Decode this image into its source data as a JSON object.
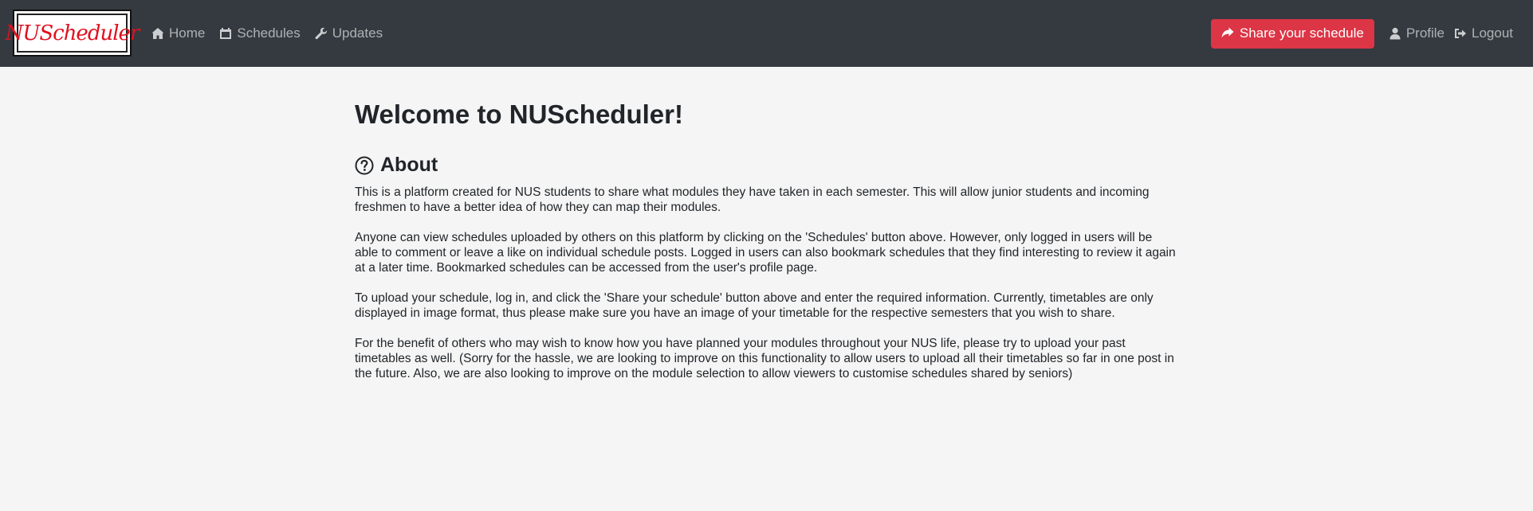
{
  "navbar": {
    "brand": "NUScheduler",
    "links": [
      {
        "icon": "home-icon",
        "label": "Home"
      },
      {
        "icon": "calendar-icon",
        "label": "Schedules"
      },
      {
        "icon": "wrench-icon",
        "label": "Updates"
      }
    ],
    "share_label": "Share your schedule",
    "profile_label": "Profile",
    "logout_label": "Logout"
  },
  "main": {
    "title": "Welcome to NUScheduler!",
    "about_heading": "About",
    "paragraphs": [
      "This is a platform created for NUS students to share what modules they have taken in each semester. This will allow junior students and incoming freshmen to have a better idea of how they can map their modules.",
      "Anyone can view schedules uploaded by others on this platform by clicking on the 'Schedules' button above. However, only logged in users will be able to comment or leave a like on individual schedule posts. Logged in users can also bookmark schedules that they find interesting to review it again at a later time. Bookmarked schedules can be accessed from the user's profile page.",
      "To upload your schedule, log in, and click the 'Share your schedule' button above and enter the required information. Currently, timetables are only displayed in image format, thus please make sure you have an image of your timetable for the respective semesters that you wish to share.",
      "For the benefit of others who may wish to know how you have planned your modules throughout your NUS life, please try to upload your past timetables as well. (Sorry for the hassle, we are looking to improve on this functionality to allow users to upload all their timetables so far in one post in the future. Also, we are also looking to improve on the module selection to allow viewers to customise schedules shared by seniors)"
    ]
  },
  "colors": {
    "navbar": "#343a40",
    "accent": "#dc3545",
    "background": "#f5f5f5"
  }
}
